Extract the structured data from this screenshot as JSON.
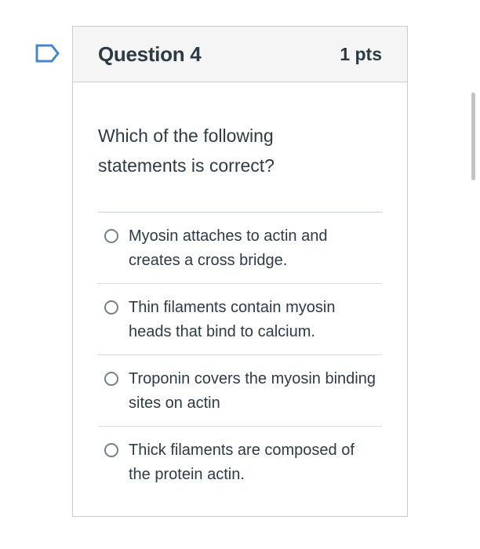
{
  "question": {
    "title": "Question 4",
    "points": "1 pts",
    "text": "Which of the following statements is correct?",
    "answers": [
      {
        "label": "Myosin attaches to actin and creates a cross bridge.",
        "selected": false
      },
      {
        "label": "Thin filaments contain myosin heads that bind to calcium.",
        "selected": false
      },
      {
        "label": "Troponin covers the myosin binding sites on actin",
        "selected": false
      },
      {
        "label": "Thick filaments are composed of the protein actin.",
        "selected": false
      }
    ]
  },
  "icons": {
    "flag": "flag-question-icon",
    "radio": "radio-button-icon"
  },
  "colors": {
    "accent": "#4a86c5",
    "text": "#2d3b45",
    "border": "#c7cdd1",
    "header_bg": "#f5f5f5"
  }
}
